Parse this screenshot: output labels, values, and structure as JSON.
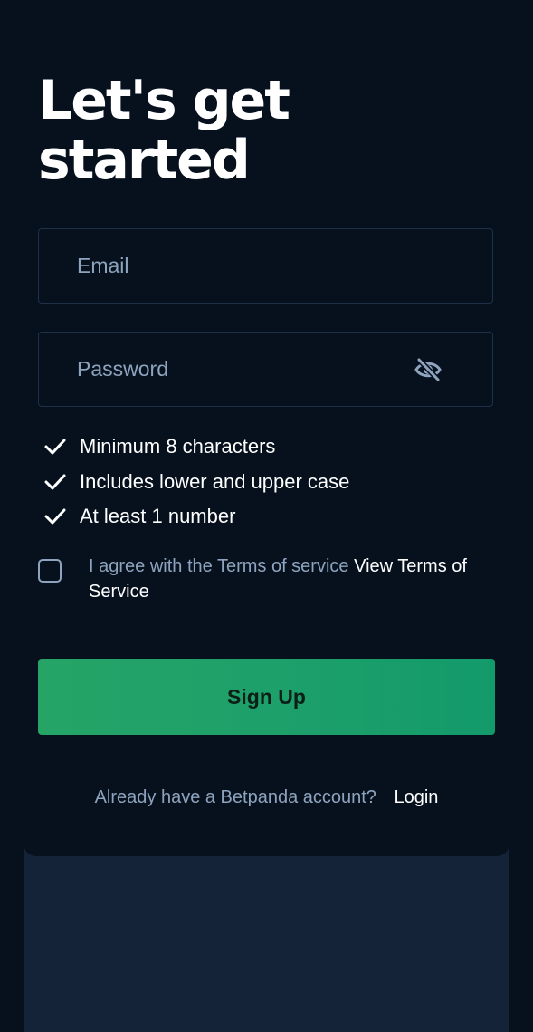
{
  "header": {
    "title_line1": "Let's get",
    "title_line2": "started"
  },
  "form": {
    "email": {
      "placeholder": "Email",
      "value": ""
    },
    "password": {
      "placeholder": "Password",
      "value": "",
      "toggle_icon": "eye-slash-icon"
    },
    "rules": [
      {
        "label": "Minimum 8 characters",
        "met": true,
        "icon": "check-icon"
      },
      {
        "label": "Includes lower and upper case",
        "met": true,
        "icon": "check-icon"
      },
      {
        "label": "At least 1 number",
        "met": true,
        "icon": "check-icon"
      }
    ],
    "agree": {
      "checked": false,
      "text": "I agree with the Terms of service",
      "link_text": "View Terms of Service"
    },
    "submit_label": "Sign Up"
  },
  "footer": {
    "question": "Already have a Betpanda account?",
    "login_label": "Login"
  },
  "colors": {
    "background": "#07111e",
    "panel": "#142338",
    "accent": "#1ea06a",
    "muted_text": "#8ea3bd",
    "border": "#1f3049"
  }
}
